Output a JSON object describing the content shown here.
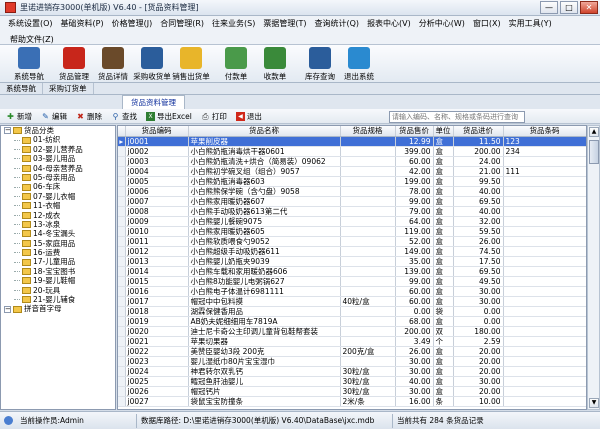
{
  "window": {
    "title": "里诺进销存3000(单机版) V6.40 - [货品资料管理]",
    "min": "—",
    "max": "□",
    "close": "✕"
  },
  "menu": {
    "items": [
      "系统设置(O)",
      "基础资料(P)",
      "价格管理(J)",
      "合同管理(R)",
      "往来业务(S)",
      "票据管理(T)",
      "查询统计(Q)",
      "报表中心(V)",
      "分析中心(W)",
      "窗口(X)",
      "实用工具(Y)"
    ],
    "help": "帮助文件(Z)"
  },
  "toolbar": [
    {
      "label": "系统导航",
      "icon": "system-nav-icon",
      "color": "#3a6fb5"
    },
    {
      "label": "货品管理",
      "icon": "apple-icon",
      "color": "#c8261b"
    },
    {
      "label": "货品详情",
      "icon": "book-icon",
      "color": "#6a4a2a"
    },
    {
      "label": "采购收货单",
      "icon": "truck-icon",
      "color": "#2b5d9b"
    },
    {
      "label": "销售出货单",
      "icon": "coin-icon",
      "color": "#e8b52a"
    },
    {
      "label": "付款单",
      "icon": "payment-icon",
      "color": "#4a9a4a"
    },
    {
      "label": "收款单",
      "icon": "receipt-icon",
      "color": "#3a8a3a"
    },
    {
      "label": "库存查询",
      "icon": "inventory-icon",
      "color": "#2b5d9b"
    },
    {
      "label": "退出系统",
      "icon": "exit-icon",
      "color": "#2a8ad0"
    }
  ],
  "nav_tabs": [
    "系统导航",
    "采购订货单"
  ],
  "doc_tab": "货品资料管理",
  "actions": {
    "add": "新增",
    "edit": "编辑",
    "delete": "删除",
    "find": "查找",
    "export": "导出Excel",
    "print": "打印",
    "exit": "退出"
  },
  "search": {
    "placeholder": "请输入编码、名称、规格或条码进行查询"
  },
  "tree": {
    "root": "货品分类",
    "children": [
      "01-纺织",
      "02-婴儿营养品",
      "03-婴儿用品",
      "04-母亲营养品",
      "05-母亲用品",
      "06-车床",
      "07-婴儿衣帽",
      "11-衣帽",
      "12-成衣",
      "13-冰泉",
      "14-冬宝漏头",
      "15-家庭用品",
      "16-运费",
      "17-儿童用品",
      "18-宝宝图书",
      "19-婴儿鞋帽",
      "20-玩具",
      "21-婴儿辅食"
    ],
    "second": "拼音首字母"
  },
  "grid": {
    "columns": [
      "货品编码",
      "货品名称",
      "货品规格",
      "货品售价",
      "单位",
      "货品进价",
      "货品条码"
    ],
    "rows": [
      [
        "j0001",
        "苹果削皮器",
        "",
        "12.99",
        "盒",
        "11.50",
        "123"
      ],
      [
        "j0002",
        "小白熊奶瓶消毒烘干器0601",
        "",
        "399.00",
        "盒",
        "200.00",
        "234"
      ],
      [
        "j0003",
        "小白熊奶瓶清洗+烘合（简易装）09062",
        "",
        "60.00",
        "盒",
        "24.00",
        ""
      ],
      [
        "j0004",
        "小白熊初学碗叉组（组合）9057",
        "",
        "42.00",
        "盒",
        "21.00",
        "111"
      ],
      [
        "j0005",
        "小白熊奶瓶消毒器603",
        "",
        "199.00",
        "盒",
        "99.50",
        ""
      ],
      [
        "j0006",
        "小白熊熊保学碗（含勺盘）9058",
        "",
        "78.00",
        "盒",
        "40.00",
        ""
      ],
      [
        "j0007",
        "小白熊家用暖奶器607",
        "",
        "99.00",
        "盒",
        "69.50",
        ""
      ],
      [
        "j0008",
        "小白熊手动吸奶器613第二代",
        "",
        "79.00",
        "盒",
        "40.00",
        ""
      ],
      [
        "j0009",
        "小白熊婴儿餐碗9075",
        "",
        "64.00",
        "盒",
        "32.00",
        ""
      ],
      [
        "j0010",
        "小白熊家用暖奶器605",
        "",
        "119.00",
        "盒",
        "59.50",
        ""
      ],
      [
        "j0011",
        "小白熊软质喂食勺9052",
        "",
        "52.00",
        "盒",
        "26.00",
        ""
      ],
      [
        "j0012",
        "小白熊超级手动吸奶器611",
        "",
        "149.00",
        "盒",
        "74.50",
        ""
      ],
      [
        "j0013",
        "小白熊婴儿奶瓶夹9039",
        "",
        "35.00",
        "盒",
        "17.50",
        ""
      ],
      [
        "j0014",
        "小白熊车载和家用暖奶器606",
        "",
        "139.00",
        "盒",
        "69.50",
        ""
      ],
      [
        "j0015",
        "小白熊8功能婴儿电粥锅627",
        "",
        "99.00",
        "盒",
        "49.50",
        ""
      ],
      [
        "j0016",
        "小白熊电子体温计6981111",
        "",
        "60.00",
        "盒",
        "30.00",
        ""
      ],
      [
        "j0017",
        "帽冠中中包料摸",
        "40粒/盒",
        "60.00",
        "盒",
        "30.00",
        ""
      ],
      [
        "j0018",
        "湖霖保健香用品",
        "",
        "0.00",
        "袋",
        "0.00",
        ""
      ],
      [
        "j0019",
        "AB奶夫妮细细用车7819A",
        "",
        "68.00",
        "盒",
        "0.00",
        ""
      ],
      [
        "j0020",
        "迪士尼卡奇公主印调儿童背包鞋帮套装",
        "",
        "200.00",
        "双",
        "180.00",
        ""
      ],
      [
        "j0021",
        "苹果切果器",
        "",
        "3.49",
        "个",
        "2.59",
        ""
      ],
      [
        "j0022",
        "美赞臣婴幼3段 200克",
        "200克/盒",
        "26.00",
        "盒",
        "20.00",
        ""
      ],
      [
        "j0023",
        "婴儿湿纸巾80片宝宝湿巾",
        "",
        "30.00",
        "盒",
        "20.00",
        ""
      ],
      [
        "j0024",
        "神君转尔双乳钙",
        "30粒/盒",
        "30.00",
        "盒",
        "20.00",
        ""
      ],
      [
        "j0025",
        "鳕冠鱼肝油婴儿",
        "30粒/盒",
        "40.00",
        "盒",
        "30.00",
        ""
      ],
      [
        "j0026",
        "帽冠钙片",
        "30粒/盒",
        "30.00",
        "盒",
        "20.00",
        ""
      ],
      [
        "j0027",
        "袋鼠宝宝防撞条",
        "2米/条",
        "16.00",
        "条",
        "10.00",
        ""
      ]
    ]
  },
  "status": {
    "operator": "当前操作员:Admin",
    "db_path": "数据库路径: D:\\里诺进销存3000(单机版) V6.40\\DataBase\\jxc.mdb",
    "count": "当前共有 284 条货品记录"
  }
}
